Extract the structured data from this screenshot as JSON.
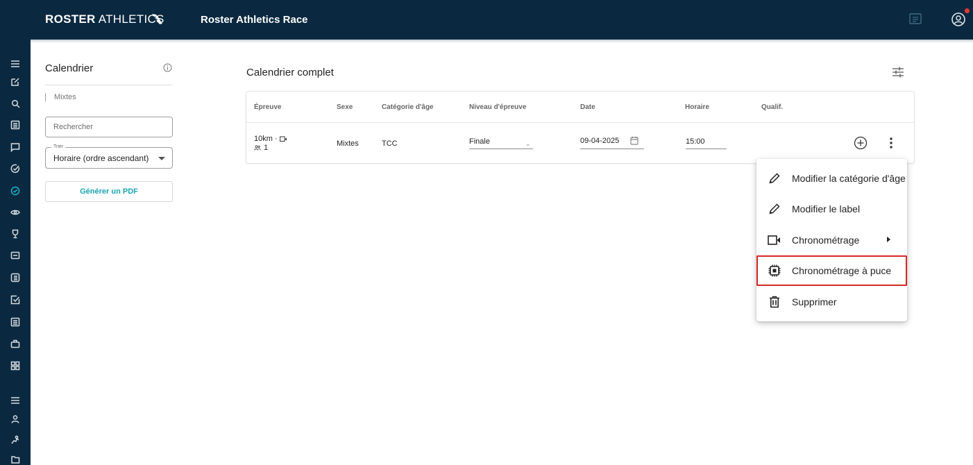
{
  "header": {
    "logo_bold": "ROSTER",
    "logo_thin": "ATHLETICS",
    "title": "Roster Athletics Race",
    "chat_icon": "chat-icon",
    "user_icon": "user-circle-icon",
    "has_notification": true
  },
  "rail": {
    "icons": [
      "menu-icon",
      "edit-icon",
      "search-icon",
      "list-icon",
      "message-icon",
      "check-circle-icon",
      "timer-icon",
      "eye-icon",
      "trophy-icon",
      "bib-icon",
      "list-box-icon",
      "checkbox-icon",
      "document-icon",
      "bag-icon",
      "grid-icon",
      "menu-icon",
      "person-icon",
      "runner-icon",
      "folders-icon"
    ],
    "active_index": 6
  },
  "left_panel": {
    "title": "Calendrier",
    "filter_label": "Mixtes",
    "search_placeholder": "Rechercher",
    "sort_legend": "Trier",
    "sort_value": "Horaire (ordre ascendant)",
    "pdf_button": "Générer un PDF"
  },
  "main": {
    "title": "Calendrier complet",
    "columns": [
      "Épreuve",
      "Sexe",
      "Catégorie d'âge",
      "Niveau d'épreuve",
      "Date",
      "Horaire",
      "Qualif."
    ],
    "row": {
      "event": "10km ·",
      "participants": "1",
      "sexe": "Mixtes",
      "categorie": "TCC",
      "niveau": "Finale",
      "date": "09-04-2025",
      "horaire": "15:00"
    }
  },
  "menu": {
    "items": [
      {
        "label": "Modifier la catégorie d'âge",
        "icon": "pencil-icon"
      },
      {
        "label": "Modifier le label",
        "icon": "pencil-icon"
      },
      {
        "label": "Chronométrage",
        "icon": "video-camera-icon",
        "submenu": true
      },
      {
        "label": "Chronométrage à puce",
        "icon": "chip-icon",
        "highlighted": true
      },
      {
        "label": "Supprimer",
        "icon": "trash-icon"
      }
    ]
  },
  "colors": {
    "navy": "#0a2940",
    "accent": "#20b3c6",
    "highlight": "#d62828"
  }
}
